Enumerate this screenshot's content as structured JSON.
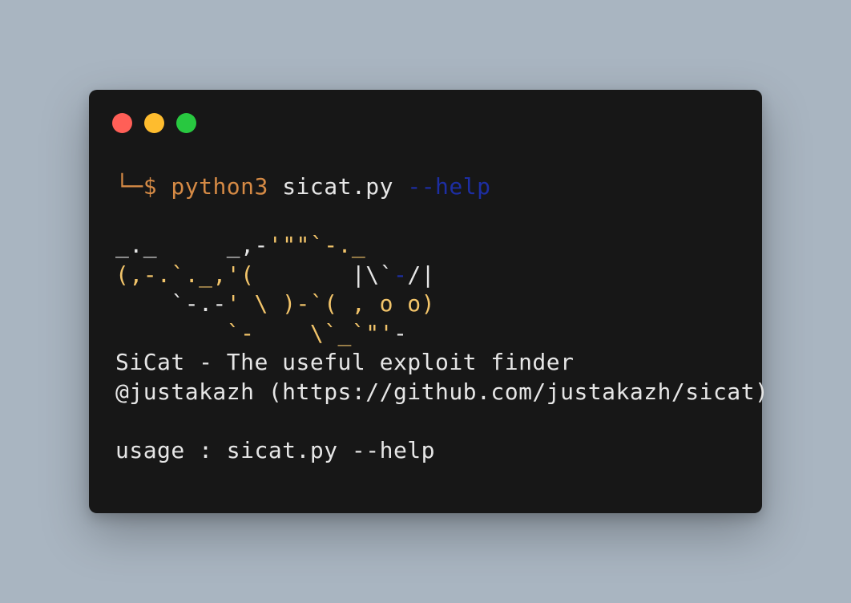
{
  "window": {
    "background": "#171717",
    "page_background": "#a9b5c1",
    "traffic_lights": [
      {
        "name": "close",
        "color": "#ff5f57"
      },
      {
        "name": "minimize",
        "color": "#febc2e"
      },
      {
        "name": "zoom",
        "color": "#28c840"
      }
    ]
  },
  "terminal": {
    "prompt": {
      "prefix": "└─$",
      "command": "python3",
      "script": "sicat.py",
      "flag": "--help"
    },
    "ascii_art": {
      "line1_white": "_._",
      "line1_gap": "     ",
      "line1_white2": "_,-",
      "line1_gold": "'\"\"`-._",
      "line2_gold": "(,-.`._,'(",
      "line2_gap": "       ",
      "line2_white": "|\\`",
      "line2_blue": "-",
      "line2_white2": "/|",
      "line3_white": "    `-.-",
      "line3_gold": "' \\ )-`( , o o)",
      "line4_gold": "        `-    \\`_`\"'",
      "line4_white": "-"
    },
    "title": "SiCat - The useful exploit finder",
    "author": "@justakazh (https://github.com/justakazh/sicat)",
    "usage": "usage : sicat.py --help"
  },
  "colors": {
    "text": "#e6e6e6",
    "command": "#d58a45",
    "flag": "#1d2ea3",
    "ascii_accent": "#f2c46a"
  }
}
